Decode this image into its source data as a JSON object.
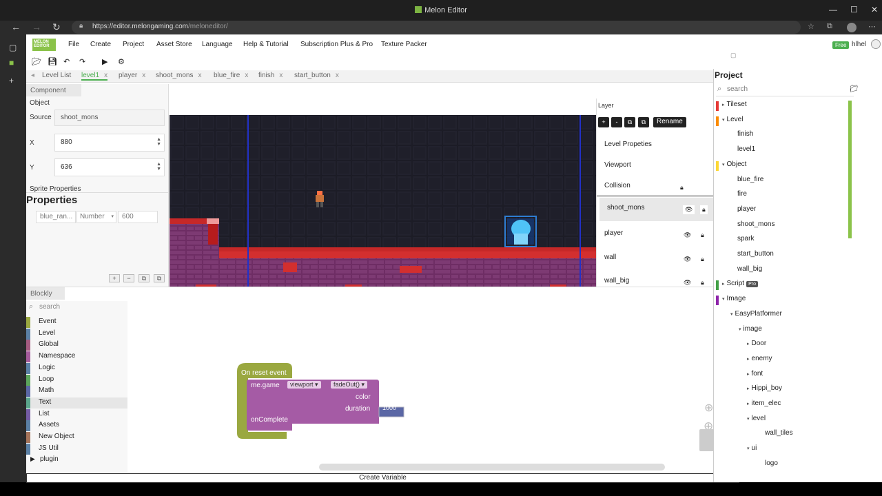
{
  "window": {
    "title": "Melon Editor",
    "min": "—",
    "max": "☐",
    "close": "✕"
  },
  "browser": {
    "url_host": "https://editor.melongaming.com",
    "url_path": "/meloneditor/"
  },
  "menubar": {
    "logo": "MELON EDITOR",
    "items": [
      "File",
      "Create",
      "Project",
      "Asset Store",
      "Language",
      "Help & Tutorial",
      "Subscription Plus & Pro",
      "Texture Packer"
    ],
    "badge": "Free",
    "user": "hlhel"
  },
  "tabs": [
    "Level List",
    "level1",
    "player",
    "shoot_mons",
    "blue_fire",
    "finish",
    "start_button"
  ],
  "tab_close": "x",
  "component": {
    "header": "Component",
    "object_label": "Object",
    "source_label": "Source",
    "source_value": "shoot_mons",
    "x_label": "X",
    "x_value": "880",
    "y_label": "Y",
    "y_value": "636",
    "sprite_props": "Sprite Properties",
    "props_title": "Properties",
    "prop_name": "blue_ran...",
    "prop_type": "Number",
    "prop_value": "600"
  },
  "layer": {
    "title": "Layer",
    "buttons": [
      "+",
      "-",
      "⧉",
      "⧉"
    ],
    "rename": "Rename",
    "items": [
      "Level Propeties",
      "Viewport",
      "Collision",
      "shoot_mons",
      "player",
      "wall",
      "wall_big"
    ]
  },
  "blockly": {
    "header": "Blockly",
    "search_placeholder": "search",
    "categories": [
      {
        "name": "Event",
        "color": "#9aa840"
      },
      {
        "name": "Level",
        "color": "#5b80a5"
      },
      {
        "name": "Global",
        "color": "#a55b80"
      },
      {
        "name": "Namespace",
        "color": "#a55b9b"
      },
      {
        "name": "Logic",
        "color": "#5b80a5"
      },
      {
        "name": "Loop",
        "color": "#5ba55b"
      },
      {
        "name": "Math",
        "color": "#5b67a5"
      },
      {
        "name": "Text",
        "color": "#5ba58c"
      },
      {
        "name": "List",
        "color": "#745ba5"
      },
      {
        "name": "Assets",
        "color": "#5b80a5"
      },
      {
        "name": "New Object",
        "color": "#a5745b"
      },
      {
        "name": "JS Util",
        "color": "#5b80a5"
      },
      {
        "name": "plugin",
        "color": ""
      }
    ],
    "block": {
      "event": "On reset event",
      "target": "me.game",
      "dropdown1": "viewport ▾",
      "dropdown2": "fadeOut() ▾",
      "color_label": "color",
      "duration_label": "duration",
      "duration_value": "1000",
      "oncomplete": "onComplete"
    },
    "create_variable": "Create Variable"
  },
  "project": {
    "title": "Project",
    "search_placeholder": "search",
    "tree": [
      {
        "label": "Tileset",
        "level": 0,
        "bar": "#e53935",
        "arrow": "▸"
      },
      {
        "label": "Level",
        "level": 0,
        "bar": "#fb8c00",
        "arrow": "▾"
      },
      {
        "label": "finish",
        "level": 1,
        "bar": "",
        "arrow": ""
      },
      {
        "label": "level1",
        "level": 1,
        "bar": "",
        "arrow": ""
      },
      {
        "label": "Object",
        "level": 0,
        "bar": "#fdd835",
        "arrow": "▾"
      },
      {
        "label": "blue_fire",
        "level": 1,
        "bar": "",
        "arrow": ""
      },
      {
        "label": "fire",
        "level": 1,
        "bar": "",
        "arrow": ""
      },
      {
        "label": "player",
        "level": 1,
        "bar": "",
        "arrow": ""
      },
      {
        "label": "shoot_mons",
        "level": 1,
        "bar": "",
        "arrow": ""
      },
      {
        "label": "spark",
        "level": 1,
        "bar": "",
        "arrow": ""
      },
      {
        "label": "start_button",
        "level": 1,
        "bar": "",
        "arrow": ""
      },
      {
        "label": "wall_big",
        "level": 1,
        "bar": "",
        "arrow": ""
      },
      {
        "label": "Script",
        "level": 0,
        "bar": "#43a047",
        "arrow": "▸",
        "pro": "Pro"
      },
      {
        "label": "Image",
        "level": 0,
        "bar": "#8e24aa",
        "arrow": "▾"
      },
      {
        "label": "EasyPlatformer",
        "level": 1,
        "bar": "",
        "arrow": "▾"
      },
      {
        "label": "image",
        "level": 2,
        "bar": "",
        "arrow": "▾"
      },
      {
        "label": "Door",
        "level": 3,
        "bar": "",
        "arrow": "▸"
      },
      {
        "label": "enemy",
        "level": 3,
        "bar": "",
        "arrow": "▸"
      },
      {
        "label": "font",
        "level": 3,
        "bar": "",
        "arrow": "▸"
      },
      {
        "label": "Hippi_boy",
        "level": 3,
        "bar": "",
        "arrow": "▸"
      },
      {
        "label": "item_elec",
        "level": 3,
        "bar": "",
        "arrow": "▸"
      },
      {
        "label": "level",
        "level": 3,
        "bar": "",
        "arrow": "▾"
      },
      {
        "label": "wall_tiles",
        "level": 4,
        "bar": "",
        "arrow": ""
      },
      {
        "label": "ui",
        "level": 3,
        "bar": "",
        "arrow": "▾"
      },
      {
        "label": "logo",
        "level": 4,
        "bar": "",
        "arrow": ""
      }
    ]
  },
  "colors": {
    "accent": "#4caf50",
    "block_event": "#9aa840",
    "block_call": "#a55ba5",
    "number_field": "#5b67a5"
  }
}
